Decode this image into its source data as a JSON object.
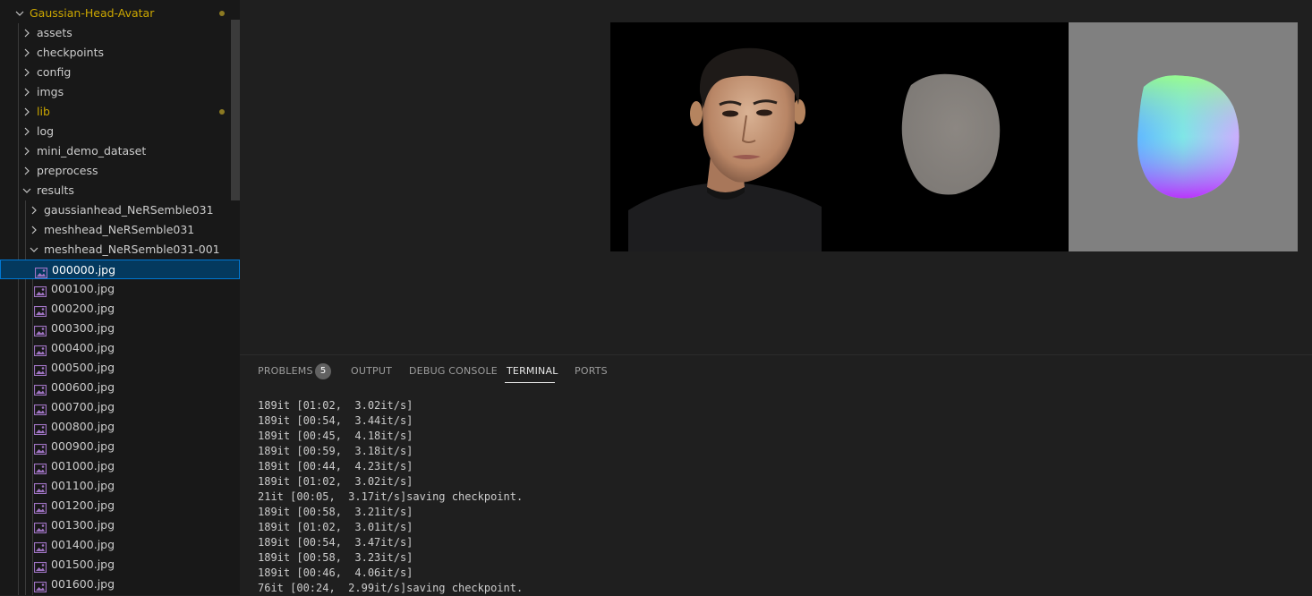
{
  "explorer": {
    "root": {
      "label": "Gaussian-Head-Avatar",
      "modified": true
    },
    "folders": [
      {
        "label": "assets",
        "modified": false
      },
      {
        "label": "checkpoints",
        "modified": false
      },
      {
        "label": "config",
        "modified": false
      },
      {
        "label": "imgs",
        "modified": false
      },
      {
        "label": "lib",
        "modified": true
      },
      {
        "label": "log",
        "modified": false
      },
      {
        "label": "mini_demo_dataset",
        "modified": false
      },
      {
        "label": "preprocess",
        "modified": false
      },
      {
        "label": "results",
        "expanded": true
      }
    ],
    "results_children": [
      {
        "label": "gaussianhead_NeRSemble031",
        "expanded": false
      },
      {
        "label": "meshhead_NeRSemble031",
        "expanded": false
      },
      {
        "label": "meshhead_NeRSemble031-001",
        "expanded": true
      }
    ],
    "files": [
      "000000.jpg",
      "000100.jpg",
      "000200.jpg",
      "000300.jpg",
      "000400.jpg",
      "000500.jpg",
      "000600.jpg",
      "000700.jpg",
      "000800.jpg",
      "000900.jpg",
      "001000.jpg",
      "001100.jpg",
      "001200.jpg",
      "001300.jpg",
      "001400.jpg",
      "001500.jpg",
      "001600.jpg"
    ],
    "selected_file": "000000.jpg",
    "icons": {
      "folder_toggle": "chevron-icon",
      "file": "image-file-icon"
    },
    "colors": {
      "modified_text": "#cca700",
      "selected_bg": "#04395e",
      "selected_border": "#0078d4",
      "file_icon": "#a074c4"
    }
  },
  "preview": {
    "panels": [
      "photo-render",
      "mesh-shading",
      "normal-map"
    ]
  },
  "panel": {
    "tabs": [
      {
        "label": "PROBLEMS",
        "badge": "5"
      },
      {
        "label": "OUTPUT"
      },
      {
        "label": "DEBUG CONSOLE"
      },
      {
        "label": "TERMINAL",
        "active": true
      },
      {
        "label": "PORTS"
      }
    ]
  },
  "terminal": {
    "lines": [
      "189it [01:02,  3.02it/s]",
      "189it [00:54,  3.44it/s]",
      "189it [00:45,  4.18it/s]",
      "189it [00:59,  3.18it/s]",
      "189it [00:44,  4.23it/s]",
      "189it [01:02,  3.02it/s]",
      "21it [00:05,  3.17it/s]saving checkpoint.",
      "189it [00:58,  3.21it/s]",
      "189it [01:02,  3.01it/s]",
      "189it [00:54,  3.47it/s]",
      "189it [00:58,  3.23it/s]",
      "189it [00:46,  4.06it/s]",
      "76it [00:24,  2.99it/s]saving checkpoint."
    ]
  }
}
